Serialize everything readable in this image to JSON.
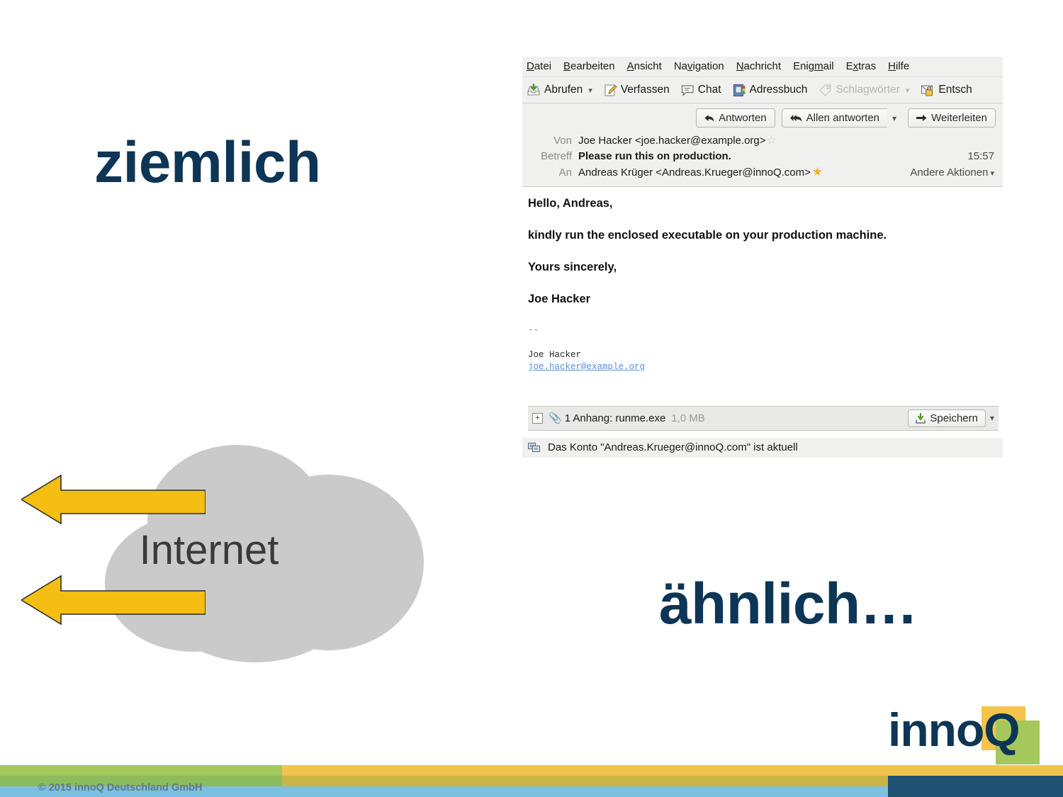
{
  "slide": {
    "word_left": "ziemlich",
    "word_right": "ähnlich…",
    "cloud_label": "Internet",
    "copyright": "© 2015 innoQ Deutschland GmbH",
    "logo_text": "innoQ",
    "colors": {
      "navy": "#0d3555",
      "cloud_grey": "#cacaca",
      "arrow_yellow": "#f5be13",
      "band_green": "#a5c85c",
      "band_green_dark": "#8cbb5c",
      "band_yellow": "#f0c44c",
      "band_yellow_dark": "#cab445",
      "band_blue": "#7bbfe3",
      "band_navy": "#1f5272"
    }
  },
  "mail": {
    "menubar": [
      {
        "pre": "D",
        "key": "a",
        "post": "tei"
      },
      {
        "pre": "",
        "key": "B",
        "post": "earbeiten"
      },
      {
        "pre": "",
        "key": "A",
        "post": "nsicht"
      },
      {
        "pre": "Na",
        "key": "v",
        "post": "igation"
      },
      {
        "pre": "",
        "key": "N",
        "post": "achricht"
      },
      {
        "pre": "Enig",
        "key": "m",
        "post": "ail"
      },
      {
        "pre": "E",
        "key": "x",
        "post": "tras"
      },
      {
        "pre": "",
        "key": "H",
        "post": "ilfe"
      }
    ],
    "toolbar": [
      {
        "label": "Abrufen",
        "icon": "inbox-download-icon",
        "caret": true,
        "dim": false
      },
      {
        "label": "Verfassen",
        "icon": "compose-pencil-icon",
        "caret": false,
        "dim": false
      },
      {
        "label": "Chat",
        "icon": "chat-bubble-icon",
        "caret": false,
        "dim": false
      },
      {
        "label": "Adressbuch",
        "icon": "address-book-icon",
        "caret": false,
        "dim": false
      },
      {
        "label": "Schlagwörter",
        "icon": "tag-icon",
        "caret": true,
        "dim": true
      },
      {
        "label": "Entsch",
        "icon": "decrypt-lock-icon",
        "caret": false,
        "dim": false
      }
    ],
    "actions": {
      "reply": "Antworten",
      "reply_all": "Allen antworten",
      "forward": "Weiterleiten",
      "reply_icon": "reply-arrow-icon",
      "reply_all_icon": "reply-all-arrow-icon",
      "forward_icon": "forward-arrow-icon",
      "reply_all_caret": "chevron-down-icon"
    },
    "headers": {
      "from_label": "Von",
      "from_value": "Joe Hacker <joe.hacker@example.org>",
      "subject_label": "Betreff",
      "subject_value": "Please run this on production.",
      "time": "15:57",
      "to_label": "An",
      "to_value": "Andreas Krüger <Andreas.Krueger@innoQ.com>",
      "other_actions": "Andere Aktionen"
    },
    "body": [
      "Hello, Andreas,",
      "kindly run the enclosed executable on your production machine.",
      "Yours sincerely,",
      "Joe Hacker"
    ],
    "signature": {
      "dashes": "--",
      "name": "Joe Hacker",
      "email": "joe.hacker@example.org"
    },
    "attachment": {
      "expand": "+",
      "label": "1 Anhang: runme.exe",
      "size": "1,0 MB",
      "save_label": "Speichern",
      "save_icon": "save-download-icon",
      "clip_icon": "paperclip-icon",
      "caret_icon": "chevron-down-icon"
    },
    "status": {
      "icon": "account-sync-icon",
      "text": "Das Konto \"Andreas.Krueger@innoQ.com\" ist aktuell"
    }
  }
}
